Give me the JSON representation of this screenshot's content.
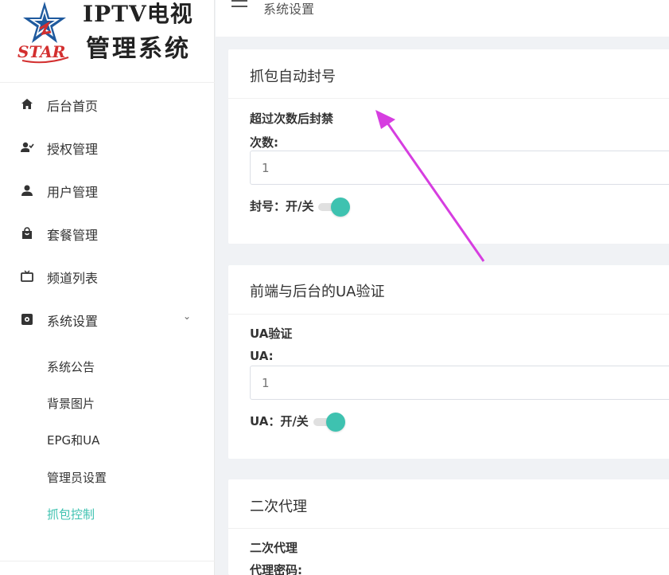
{
  "logo": {
    "title": "IPTV电视",
    "subtitle": "管理系统",
    "badge": "STAR"
  },
  "header": {
    "breadcrumb": "系统设置"
  },
  "sidebar": {
    "items": [
      {
        "label": "后台首页",
        "icon": "home-icon"
      },
      {
        "label": "授权管理",
        "icon": "user-check-icon"
      },
      {
        "label": "用户管理",
        "icon": "user-icon"
      },
      {
        "label": "套餐管理",
        "icon": "shopping-bag-icon"
      },
      {
        "label": "频道列表",
        "icon": "tv-icon"
      },
      {
        "label": "系统设置",
        "icon": "settings-icon",
        "expanded": true
      }
    ],
    "subitems": [
      {
        "label": "系统公告",
        "active": false
      },
      {
        "label": "背景图片",
        "active": false
      },
      {
        "label": "EPG和UA",
        "active": false
      },
      {
        "label": "管理员设置",
        "active": false
      },
      {
        "label": "抓包控制",
        "active": true
      }
    ]
  },
  "cards": {
    "capture": {
      "title": "抓包自动封号",
      "section": "超过次数后封禁",
      "count_label": "次数:",
      "count_placeholder": "1",
      "toggle_label": "封号：开/关",
      "toggle_on": true
    },
    "ua": {
      "title": "前端与后台的UA验证",
      "section": "UA验证",
      "ua_label": "UA:",
      "ua_placeholder": "1",
      "toggle_label": "UA：开/关",
      "toggle_on": true
    },
    "proxy": {
      "title": "二次代理",
      "section": "二次代理",
      "password_label": "代理密码:"
    }
  },
  "colors": {
    "accent": "#3ec2b0",
    "annotation": "#d63ee0"
  }
}
